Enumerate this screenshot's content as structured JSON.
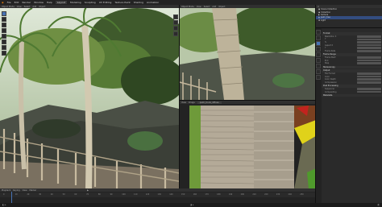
{
  "menubar": {
    "items": [
      "File",
      "Edit",
      "Render",
      "Window",
      "Help"
    ],
    "workspaces": [
      "Layout",
      "Modeling",
      "Sculpting",
      "UV Editing",
      "Texture Paint",
      "Shading",
      "Animation",
      "Rendering",
      "Compositing",
      "Scripting"
    ],
    "active_workspace": "Layout"
  },
  "viewport_main": {
    "mode": "Object Mode",
    "menus": [
      "View",
      "Select",
      "Add",
      "Object"
    ]
  },
  "viewport_camera": {
    "mode": "Object Mode",
    "menus": [
      "View",
      "Select",
      "Add",
      "Object"
    ]
  },
  "image_editor": {
    "menus": [
      "View",
      "Image"
    ],
    "image_name": "palm_trunk_diffuse"
  },
  "outliner": {
    "items": [
      {
        "label": "Scene Collection",
        "selected": false
      },
      {
        "label": "Collection",
        "selected": false
      },
      {
        "label": "Camera",
        "selected": false
      },
      {
        "label": "palm_tree",
        "selected": true
      },
      {
        "label": "Light",
        "selected": false
      }
    ]
  },
  "properties": {
    "sections": [
      "Output",
      "Format",
      "Frame Range",
      "Stereoscopy",
      "Output",
      "Post Processing",
      "Metadata"
    ],
    "fields": [
      "Resolution X",
      "Y",
      "%",
      "Aspect X",
      "Y",
      "Frame Rate",
      "Frame Start",
      "End",
      "Step",
      "File Format",
      "Color",
      "Color Depth",
      "Compression",
      "Sequencer",
      "Compositing"
    ]
  },
  "timeline": {
    "menus": [
      "Playback",
      "Keying",
      "View",
      "Marker"
    ],
    "frame_numbers": [
      "0",
      "10",
      "20",
      "30",
      "40",
      "50",
      "60",
      "70",
      "80",
      "90",
      "100",
      "110",
      "120",
      "130",
      "140",
      "150",
      "160",
      "170",
      "180",
      "190",
      "200",
      "210",
      "220",
      "230",
      "240",
      "250"
    ]
  },
  "colors": {
    "accent": "#4772b3",
    "header": "#303030",
    "panel": "#2a2a2a",
    "trunk_green": "#6e9a3a",
    "swatch_yellow": "#e0d21a",
    "swatch_red": "#c2231e"
  }
}
